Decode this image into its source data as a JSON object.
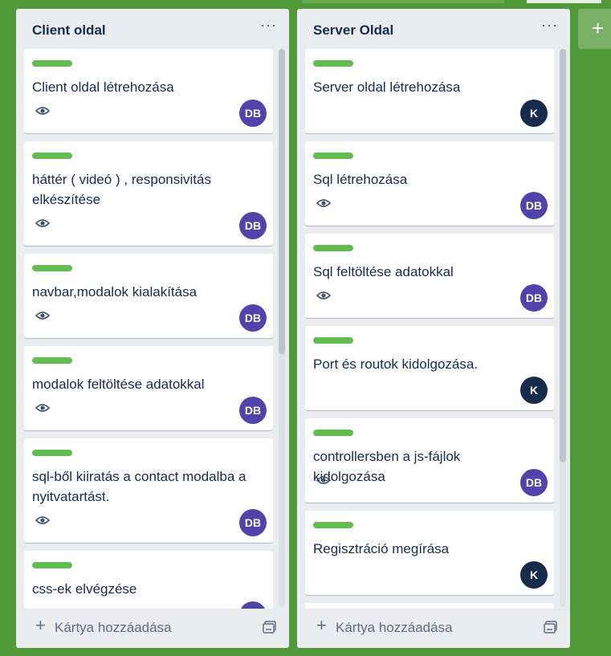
{
  "lists": [
    {
      "title": "Client oldal",
      "add_card_label": "Kártya hozzáadása",
      "cards": [
        {
          "title": "Client oldal létrehozása",
          "avatar": "DB",
          "watch": true
        },
        {
          "title": "háttér ( videó ) , responsivitás elkészítése",
          "avatar": "DB",
          "watch": true
        },
        {
          "title": "navbar,modalok kialakítása",
          "avatar": "DB",
          "watch": true
        },
        {
          "title": "modalok feltöltése adatokkal",
          "avatar": "DB",
          "watch": true
        },
        {
          "title": "sql-ből kiiratás a contact modalba a nyitvatartást.",
          "avatar": "DB",
          "watch": true
        },
        {
          "title": "css-ek elvégzése",
          "avatar": "DB",
          "watch": true
        }
      ]
    },
    {
      "title": "Server Oldal",
      "add_card_label": "Kártya hozzáadása",
      "cards": [
        {
          "title": "Server oldal létrehozása",
          "avatar": "K",
          "watch": false
        },
        {
          "title": "Sql létrehozása",
          "avatar": "DB",
          "watch": true
        },
        {
          "title": "Sql feltöltése adatokkal",
          "avatar": "DB",
          "watch": true
        },
        {
          "title": "Port és routok kidolgozása.",
          "avatar": "K",
          "watch": false
        },
        {
          "title": "controllersben a js-fájlok kidolgozása",
          "avatar": "DB",
          "watch": true
        },
        {
          "title": "Regisztráció megírása",
          "avatar": "K",
          "watch": false
        }
      ]
    }
  ],
  "add_list_label": "+",
  "colors": {
    "board_bg": "#519839",
    "label_green": "#61bd4f",
    "avatar_db": "#5243aa",
    "avatar_k": "#172b4d"
  }
}
